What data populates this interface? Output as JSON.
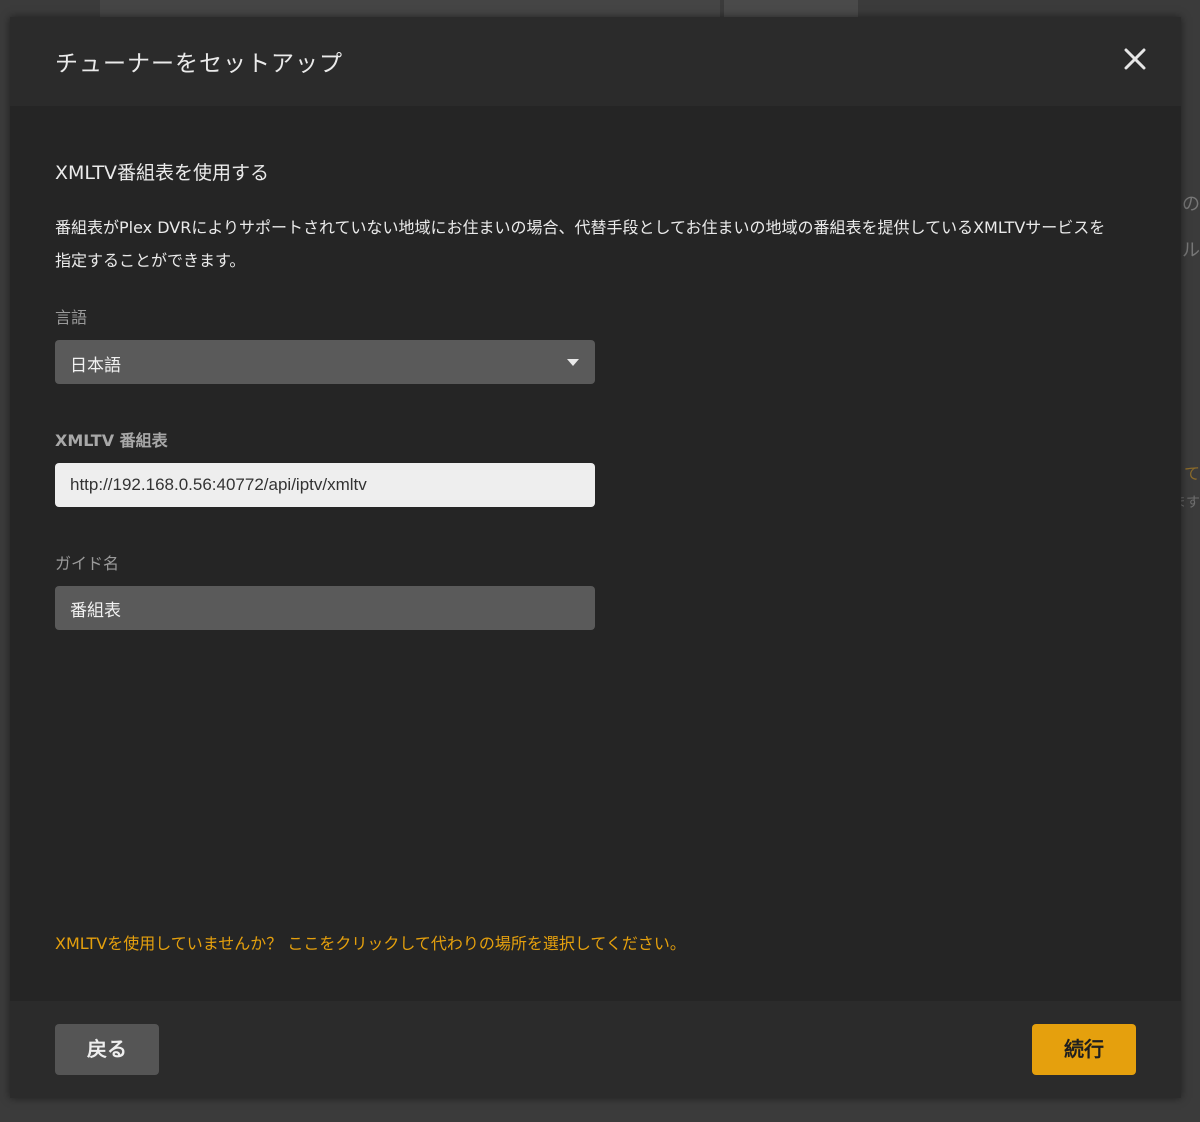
{
  "modal": {
    "title": "チューナーをセットアップ",
    "close_icon": "close-icon"
  },
  "section": {
    "title": "XMLTV番組表を使用する",
    "description": "番組表がPlex DVRによりサポートされていない地域にお住まいの場合、代替手段としてお住まいの地域の番組表を提供しているXMLTVサービスを指定することができます。"
  },
  "fields": {
    "language": {
      "label": "言語",
      "value": "日本語"
    },
    "xmltv": {
      "label": "XMLTV 番組表",
      "value": "http://192.168.0.56:40772/api/iptv/xmltv"
    },
    "guide_name": {
      "label": "ガイド名",
      "value": "番組表"
    }
  },
  "alt_link": "XMLTVを使用していませんか？ ここをクリックして代わりの場所を選択してください。",
  "footer": {
    "back_label": "戻る",
    "continue_label": "続行"
  },
  "background": {
    "peek_1": "の",
    "peek_2": "ル",
    "peek_3": "て",
    "peek_4": "ます"
  },
  "colors": {
    "accent": "#e5a00d",
    "modal_bg": "#252525",
    "header_bg": "#2b2b2b",
    "input_dark": "#5a5a5a",
    "input_light": "#eeeeee"
  }
}
